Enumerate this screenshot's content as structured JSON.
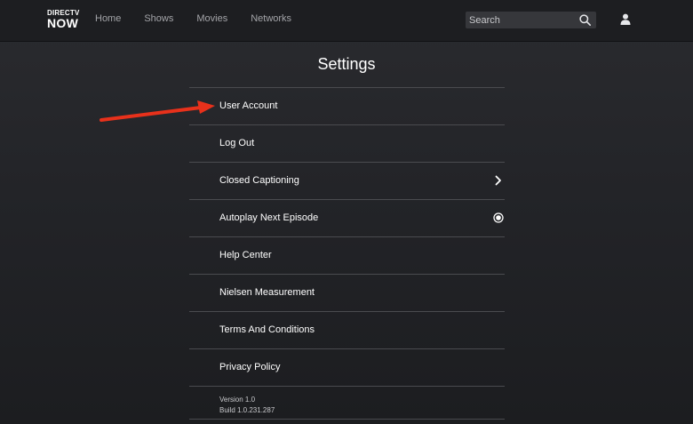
{
  "header": {
    "logo": {
      "line1": "DIRECTV",
      "line2": "NOW"
    },
    "nav": [
      {
        "label": "Home"
      },
      {
        "label": "Shows"
      },
      {
        "label": "Movies"
      },
      {
        "label": "Networks"
      }
    ],
    "search": {
      "placeholder": "Search",
      "icon": "search-icon"
    },
    "user_icon": "user-icon"
  },
  "settings": {
    "title": "Settings",
    "items": [
      {
        "label": "User Account"
      },
      {
        "label": "Log Out"
      },
      {
        "label": "Closed Captioning",
        "icon": "chevron-right-icon"
      },
      {
        "label": "Autoplay Next Episode",
        "icon": "radio-selected-icon"
      },
      {
        "label": "Help Center"
      },
      {
        "label": "Nielsen Measurement"
      },
      {
        "label": "Terms And Conditions"
      },
      {
        "label": "Privacy Policy"
      }
    ],
    "version": "Version 1.0",
    "build": "Build 1.0.231.287"
  },
  "annotation": {
    "arrow_color": "#e8311b",
    "points_to": "User Account"
  },
  "colors": {
    "background": "#232428",
    "header": "#1d1e21",
    "divider": "#4a4b4f",
    "text": "#ffffff",
    "nav_text": "#a3a4a8"
  }
}
